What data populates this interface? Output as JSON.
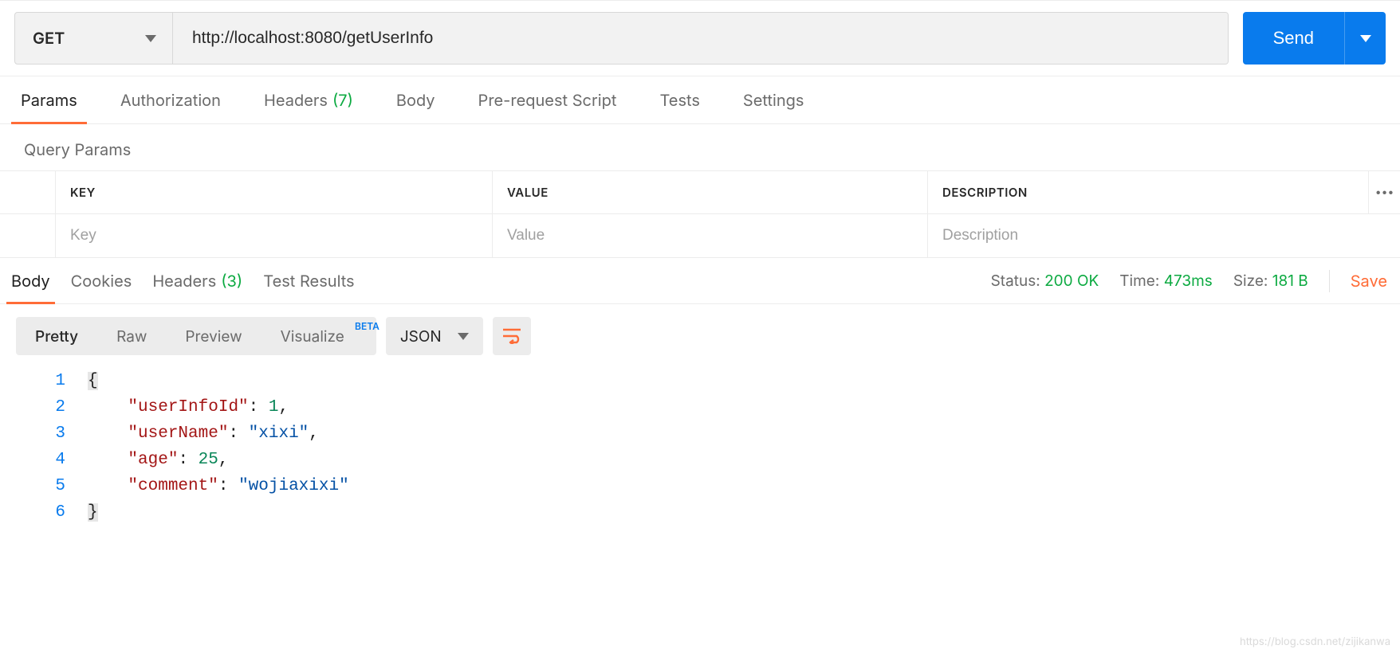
{
  "request": {
    "method": "GET",
    "url": "http://localhost:8080/getUserInfo",
    "send_label": "Send"
  },
  "req_tabs": {
    "params": "Params",
    "authorization": "Authorization",
    "headers": "Headers",
    "headers_count": "(7)",
    "body": "Body",
    "pre_request": "Pre-request Script",
    "tests": "Tests",
    "settings": "Settings"
  },
  "query_params": {
    "title": "Query Params",
    "columns": {
      "key": "KEY",
      "value": "VALUE",
      "description": "DESCRIPTION"
    },
    "placeholders": {
      "key": "Key",
      "value": "Value",
      "description": "Description"
    }
  },
  "resp_tabs": {
    "body": "Body",
    "cookies": "Cookies",
    "headers": "Headers",
    "headers_count": "(3)",
    "test_results": "Test Results"
  },
  "status": {
    "status_label": "Status:",
    "status_value": "200 OK",
    "time_label": "Time:",
    "time_value": "473ms",
    "size_label": "Size:",
    "size_value": "181 B",
    "save": "Save"
  },
  "format_bar": {
    "pretty": "Pretty",
    "raw": "Raw",
    "preview": "Preview",
    "visualize": "Visualize",
    "beta": "BETA",
    "format": "JSON"
  },
  "response_body": {
    "userInfoId": 1,
    "userName": "xixi",
    "age": 25,
    "comment": "wojiaxixi"
  },
  "code_lines": [
    "1",
    "2",
    "3",
    "4",
    "5",
    "6"
  ],
  "watermark": "https://blog.csdn.net/zijikanwa"
}
